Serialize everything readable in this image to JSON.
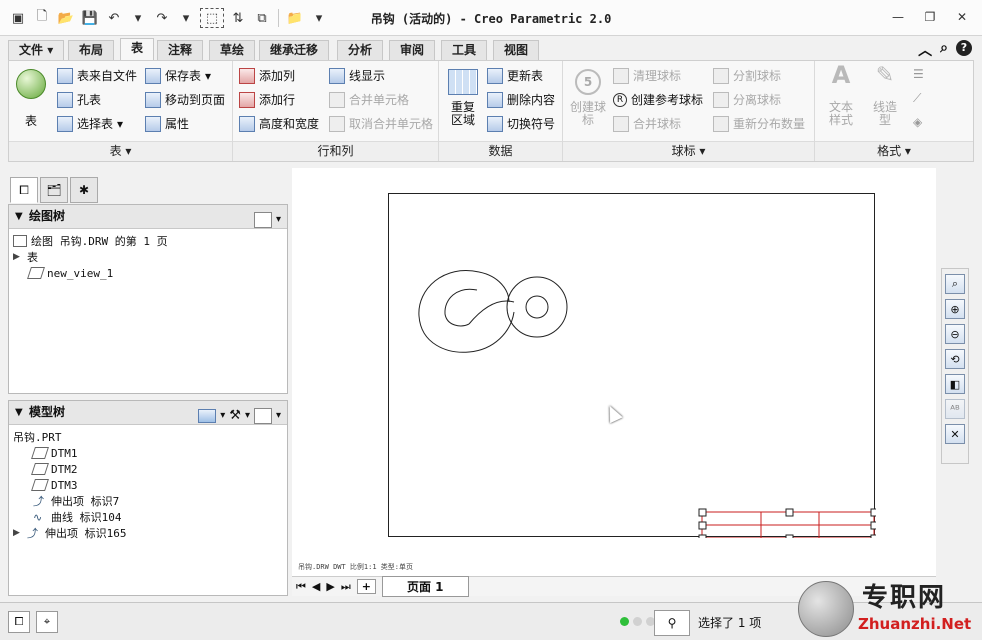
{
  "window": {
    "title": "吊钩 (活动的) - Creo Parametric 2.0"
  },
  "ribbon_tabs": [
    "文件",
    "布局",
    "表",
    "注释",
    "草绘",
    "继承迁移",
    "分析",
    "审阅",
    "工具",
    "视图"
  ],
  "active_tab": "表",
  "groups": {
    "table": {
      "label": "表",
      "big_button": "表",
      "buttons": [
        "表来自文件",
        "孔表",
        "选择表",
        "保存表",
        "移动到页面",
        "属性"
      ]
    },
    "rows_cols": {
      "label": "行和列",
      "buttons": [
        "添加列",
        "添加行",
        "高度和宽度",
        "线显示",
        "合并单元格",
        "取消合并单元格"
      ]
    },
    "data": {
      "label": "数据",
      "big_button": "重复\n区域",
      "buttons": [
        "更新表",
        "删除内容",
        "切换符号"
      ]
    },
    "balloons": {
      "label": "球标",
      "big_button": "创建球\n标",
      "buttons": [
        "清理球标",
        "创建参考球标",
        "合并球标",
        "分割球标",
        "分离球标",
        "重新分布数量"
      ]
    },
    "format": {
      "label": "格式",
      "big_buttons": [
        "文本\n样式",
        "线造\n型"
      ]
    }
  },
  "drawing_tree": {
    "title": "绘图树",
    "rows": [
      "绘图 吊钩.DRW 的第 1 页",
      "表",
      "new_view_1"
    ]
  },
  "model_tree": {
    "title": "模型树",
    "rows": [
      "吊钩.PRT",
      "DTM1",
      "DTM2",
      "DTM3",
      "伸出项 标识7",
      "曲线 标识104",
      "伸出项 标识165"
    ]
  },
  "sheet": {
    "page_tab": "页面 1",
    "footer_text": "吊钩.DRW  DWT  比例1:1  类型:单页"
  },
  "status": {
    "message": "选择了 1 项"
  },
  "watermark": {
    "cn": "专职网",
    "url": "Zhuanzhi.Net"
  },
  "colors": {
    "table_red": "#c81e1e",
    "accent_blue": "#5c7fb0"
  }
}
